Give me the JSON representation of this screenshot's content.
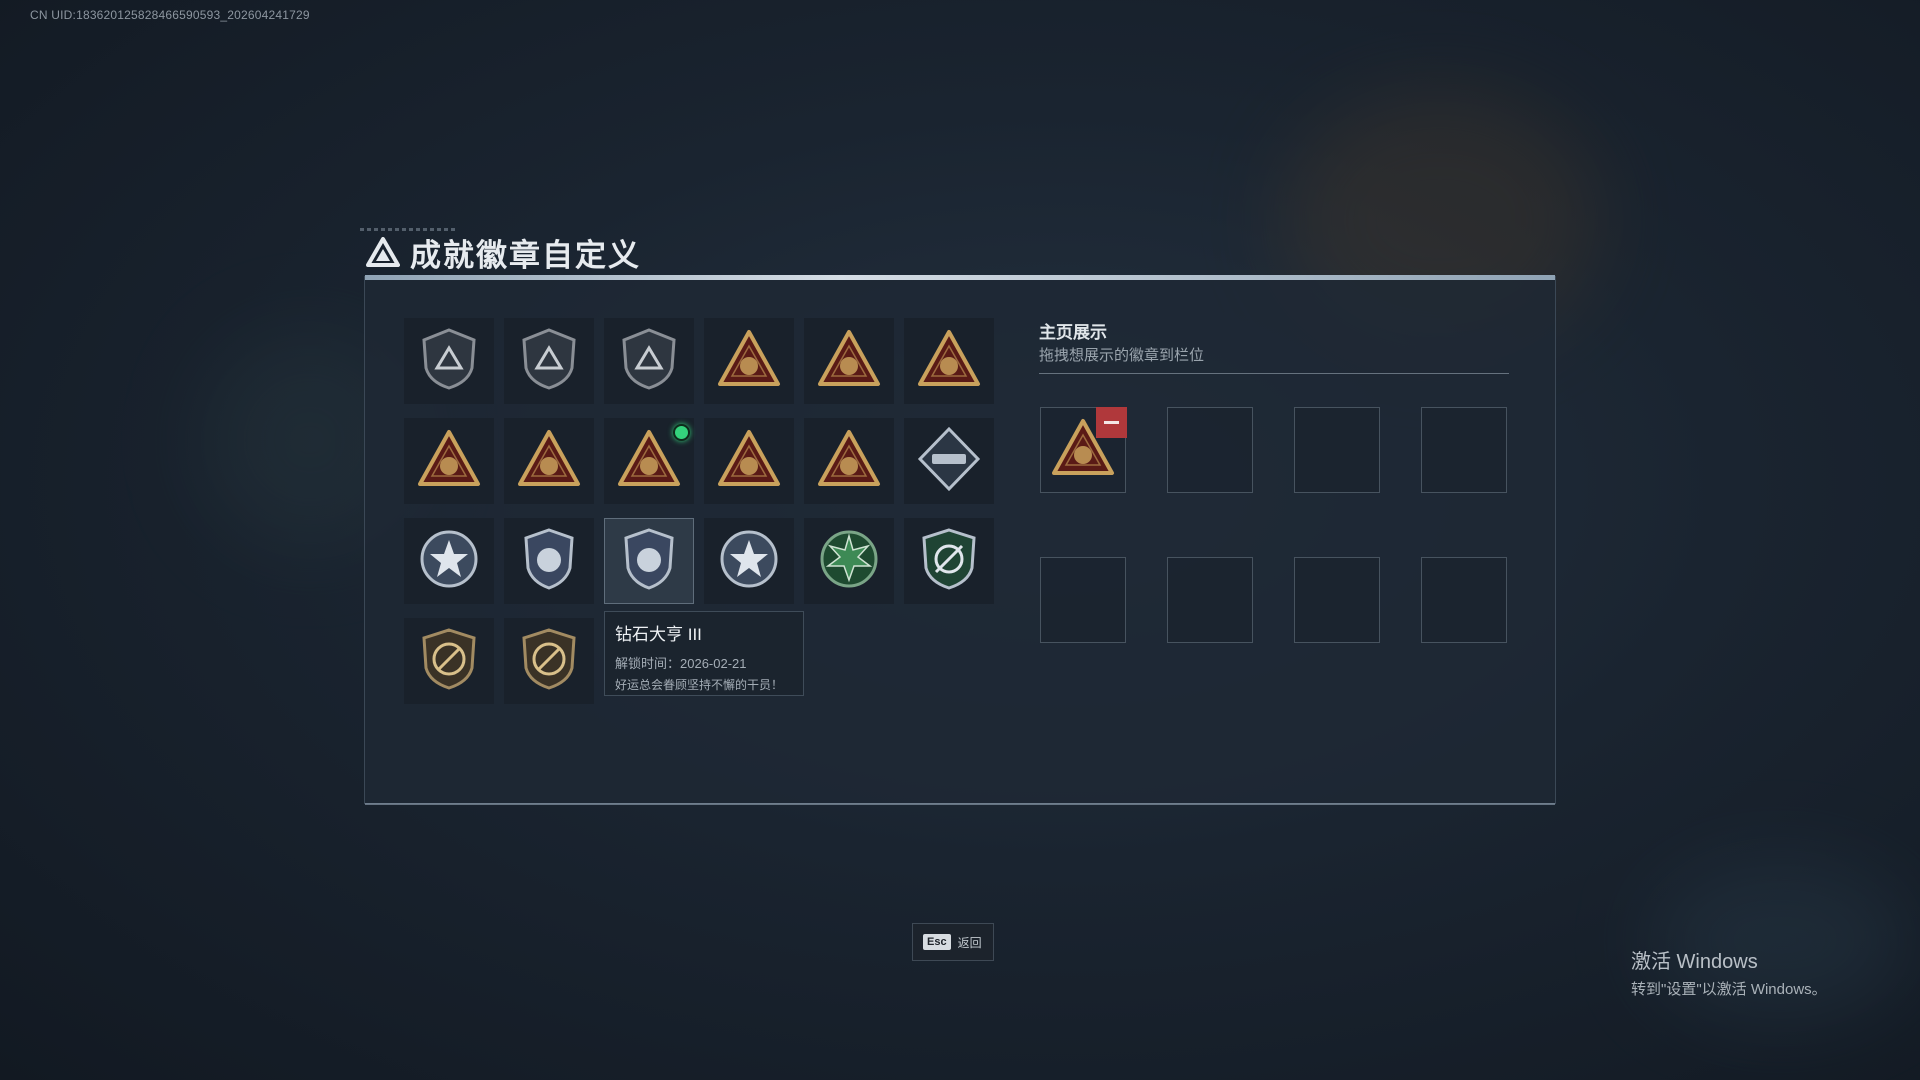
{
  "uid": "CN UID:1836201258284665905​93_202604241729",
  "header": {
    "title": "成就徽章自定义",
    "logo": "triangle-logo-icon"
  },
  "badges": [
    {
      "icon": "shield-triangle-icon",
      "style": "shield-dark"
    },
    {
      "icon": "helicopter-shield-icon",
      "style": "shield-dark"
    },
    {
      "icon": "dagger-shield-icon",
      "style": "shield-dark"
    },
    {
      "icon": "helmet-triangle-icon",
      "style": "tri-gold"
    },
    {
      "icon": "tank-triangle-icon",
      "style": "tri-gold"
    },
    {
      "icon": "number-one-triangle-icon",
      "style": "tri-gold"
    },
    {
      "icon": "bag-triangle-icon",
      "style": "tri-gold"
    },
    {
      "icon": "runner-triangle-icon",
      "style": "tri-gold"
    },
    {
      "icon": "hands-triangle-icon",
      "style": "tri-gold",
      "new": true
    },
    {
      "icon": "soldiers-triangle-icon",
      "style": "tri-gold"
    },
    {
      "icon": "rocket-triangle-icon",
      "style": "tri-gold"
    },
    {
      "icon": "gun-diamond-icon",
      "style": "diamond-silver"
    },
    {
      "icon": "star-badge-icon",
      "style": "round-silver"
    },
    {
      "icon": "police-badge-icon",
      "style": "shield-silver"
    },
    {
      "icon": "diamond-badge-icon",
      "style": "shield-silver"
    },
    {
      "icon": "skull-badge-icon",
      "style": "round-silver"
    },
    {
      "icon": "tank-green-badge-icon",
      "style": "round-green"
    },
    {
      "icon": "sniper-shield-icon",
      "style": "shield-green"
    },
    {
      "icon": "no-rifle-shield-icon",
      "style": "shield-brown"
    },
    {
      "icon": "no-pistol-shield-icon",
      "style": "shield-brown"
    }
  ],
  "tooltip": {
    "title": "钻石大亨 III",
    "unlock_time": "解锁时间：2026-02-21",
    "desc": "好运总会眷顾坚持不懈的干员！"
  },
  "showcase": {
    "title": "主页展示",
    "subtitle": "拖拽想展示的徽章到栏位",
    "slots": [
      {
        "icon": "hands-triangle-icon",
        "filled": true
      },
      {
        "filled": false
      },
      {
        "filled": false
      },
      {
        "filled": false
      },
      {
        "filled": false
      },
      {
        "filled": false
      },
      {
        "filled": false
      },
      {
        "filled": false
      }
    ]
  },
  "footer": {
    "esc_key": "Esc",
    "esc_label": "返回"
  },
  "watermark": {
    "title": "激活 Windows",
    "subtitle": "转到\"设置\"以激活 Windows。"
  },
  "colors": {
    "gold": "#c9a15c",
    "dark_red": "#5a1a16",
    "silver": "#b6c0cc",
    "green": "#3d8a55",
    "accent_new": "#34d27c",
    "remove": "#b0383b"
  }
}
